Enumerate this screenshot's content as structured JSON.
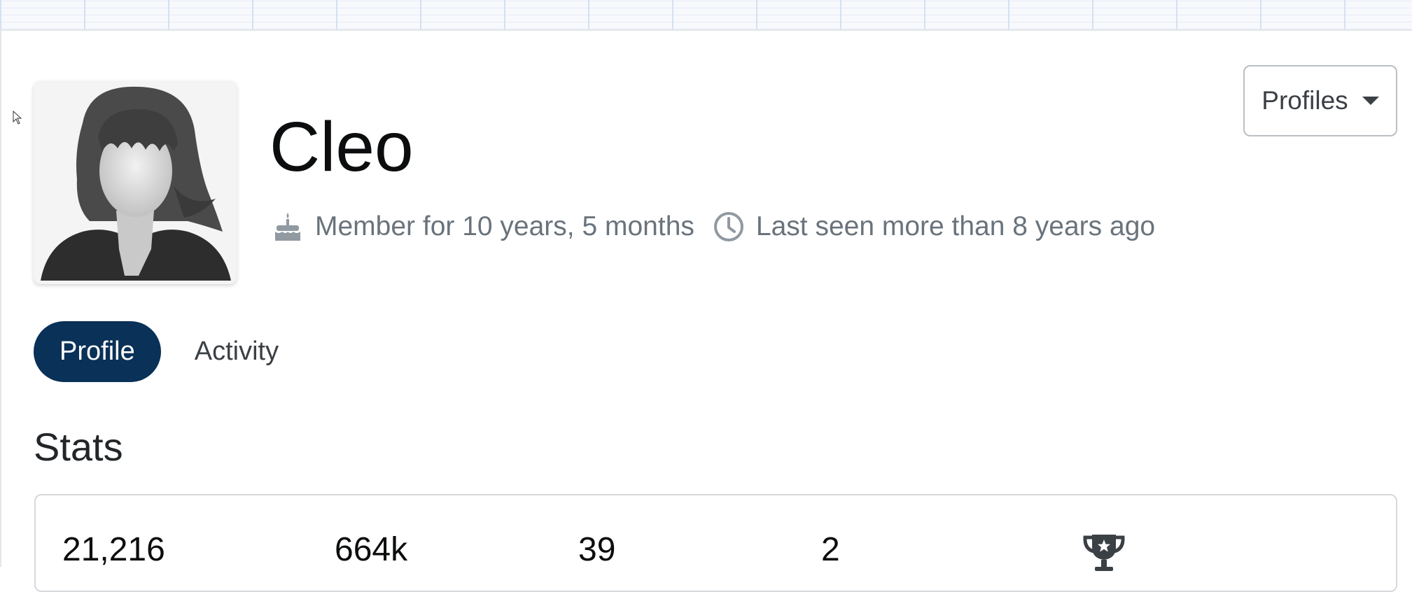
{
  "user": {
    "name": "Cleo",
    "member_for": "Member for 10 years, 5 months",
    "last_seen": "Last seen more than 8 years ago"
  },
  "profiles_menu": {
    "label": "Profiles"
  },
  "tabs": [
    {
      "label": "Profile",
      "active": true
    },
    {
      "label": "Activity",
      "active": false
    }
  ],
  "stats": {
    "title": "Stats",
    "values": [
      "21,216",
      "664k",
      "39",
      "2"
    ]
  },
  "icons": {
    "member": "cake-icon",
    "last_seen": "clock-icon",
    "profiles": "caret-down-icon",
    "badge": "trophy-icon"
  },
  "colors": {
    "active_tab_bg": "#0a3157",
    "meta_text": "#6a737c",
    "border": "#babfc4"
  }
}
